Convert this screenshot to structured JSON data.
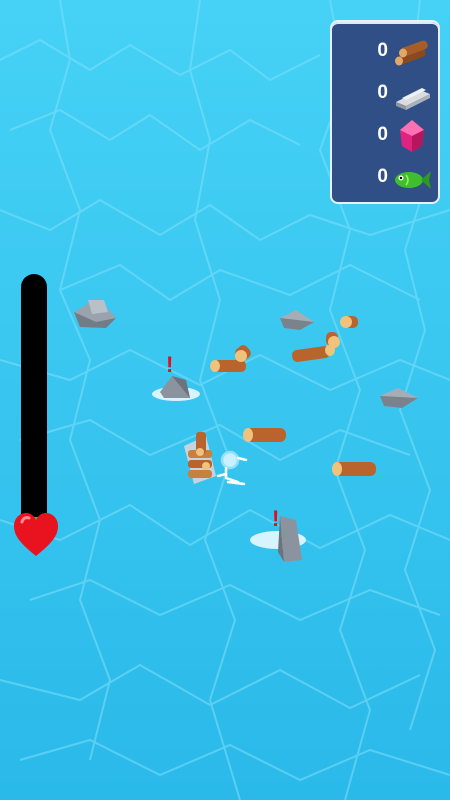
{
  "resources": [
    {
      "name": "wood",
      "count": "0",
      "icon": "wood-logs-icon"
    },
    {
      "name": "iron",
      "count": "0",
      "icon": "iron-ingot-icon"
    },
    {
      "name": "gem",
      "count": "0",
      "icon": "pink-gem-icon"
    },
    {
      "name": "fish",
      "count": "0",
      "icon": "green-fish-icon"
    }
  ],
  "health": {
    "level": 0.03,
    "bar_color": "#000000",
    "fill_color": "#17d24a",
    "heart_color": "#e8131f"
  },
  "colors": {
    "water": "#35c7ee",
    "hud_panel": "#2f4f86",
    "alert": "#e0101a"
  },
  "alerts": [
    "!",
    "!"
  ]
}
